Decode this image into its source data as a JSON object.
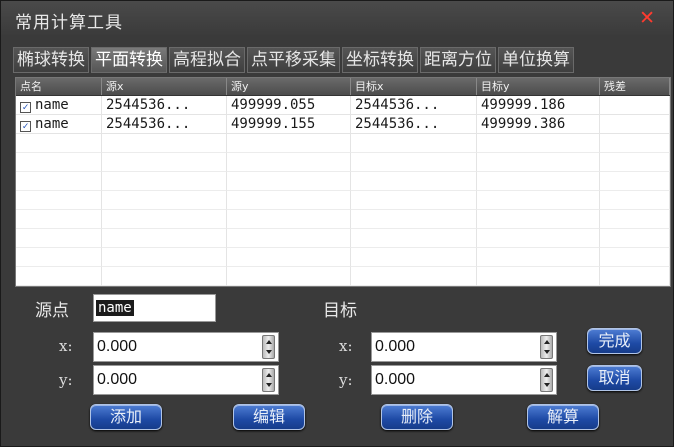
{
  "window": {
    "title": "常用计算工具",
    "close_symbol": "✕"
  },
  "tabs": [
    {
      "label": "椭球转换"
    },
    {
      "label": "平面转换",
      "active": true
    },
    {
      "label": "高程拟合"
    },
    {
      "label": "点平移采集"
    },
    {
      "label": "坐标转换"
    },
    {
      "label": "距离方位"
    },
    {
      "label": "单位换算"
    }
  ],
  "table": {
    "columns": [
      "点名",
      "源x",
      "源y",
      "目标x",
      "目标y",
      "残差"
    ],
    "rows": [
      {
        "checked": true,
        "cells": [
          "name",
          "2544536...",
          "499999.055",
          "2544536...",
          "499999.186",
          ""
        ]
      },
      {
        "checked": true,
        "cells": [
          "name",
          "2544536...",
          "499999.155",
          "2544536...",
          "499999.386",
          ""
        ]
      }
    ]
  },
  "form": {
    "source_label": "源点",
    "source_name": "name",
    "target_label": "目标",
    "x_label": "x:",
    "y_label": "y:",
    "source_x": "0.000",
    "source_y": "0.000",
    "target_x": "0.000",
    "target_y": "0.000"
  },
  "buttons": {
    "done": "完成",
    "cancel": "取消",
    "add": "添加",
    "edit": "编辑",
    "delete": "删除",
    "solve": "解算"
  },
  "colors": {
    "accent_button": "#1e4aa5",
    "close": "#ff3b2f"
  }
}
